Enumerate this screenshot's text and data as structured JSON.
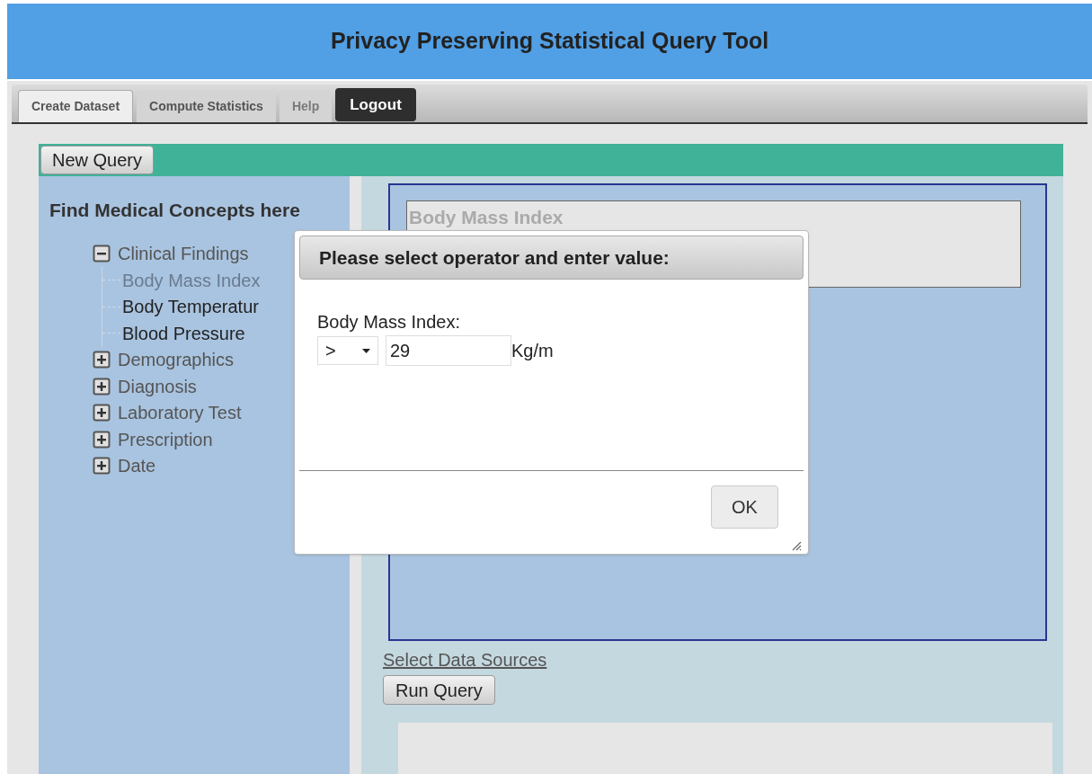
{
  "header": {
    "title": "Privacy Preserving Statistical Query Tool"
  },
  "tabs": [
    {
      "label": "Create Dataset",
      "selected": true,
      "disabled": false
    },
    {
      "label": "Compute Statistics",
      "selected": false,
      "disabled": false
    },
    {
      "label": "Help",
      "selected": false,
      "disabled": true
    }
  ],
  "logout_button": "Logout",
  "new_query_button": "New Query",
  "concept_panel": {
    "title": "Find Medical Concepts here",
    "tree": [
      {
        "label": "Clinical Findings",
        "expanded": true,
        "children": [
          {
            "label": "Body Mass Index",
            "selected": true
          },
          {
            "label": "Body Temperatur",
            "selected": false
          },
          {
            "label": "Blood Pressure",
            "selected": false
          }
        ]
      },
      {
        "label": "Demographics",
        "expanded": false
      },
      {
        "label": "Diagnosis",
        "expanded": false
      },
      {
        "label": "Laboratory Test",
        "expanded": false
      },
      {
        "label": "Prescription",
        "expanded": false
      },
      {
        "label": "Date",
        "expanded": false
      }
    ]
  },
  "query_area": {
    "criteria": [
      "Body Mass Index"
    ]
  },
  "select_data_sources_link": "Select Data Sources",
  "run_query_button": "Run Query",
  "dialog": {
    "title": "Please select operator and enter value:",
    "field_label": "Body Mass Index:",
    "operator": ">",
    "value": "29",
    "unit": "Kg/m",
    "ok_button": "OK"
  }
}
